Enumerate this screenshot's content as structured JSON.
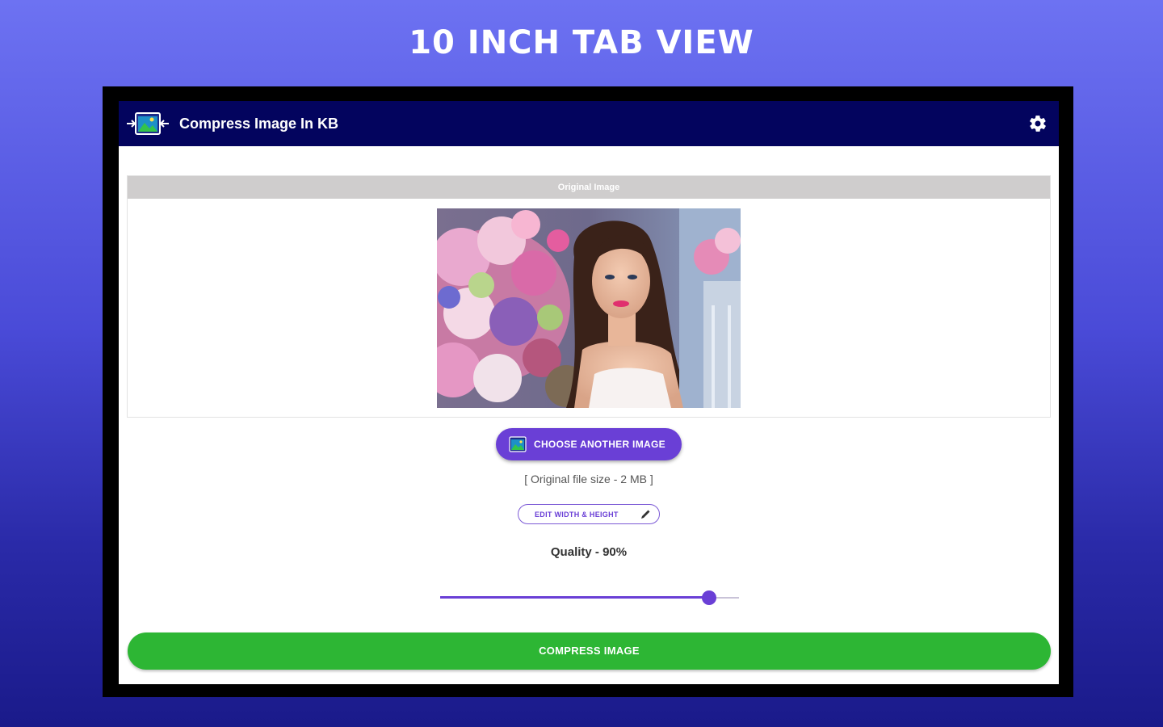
{
  "promo": {
    "title": "10 INCH TAB VIEW"
  },
  "app_bar": {
    "title": "Compress Image In KB",
    "logo_icon": "compress-image-logo-icon",
    "settings_icon": "gear-icon",
    "background_color": "#03045e"
  },
  "original_card": {
    "header": "Original Image",
    "image_description_icon": "photo"
  },
  "actions": {
    "choose_label": "CHOOSE ANOTHER IMAGE",
    "choose_icon": "image-icon",
    "file_size_text": "[ Original file size - 2 MB ]",
    "edit_label": "EDIT WIDTH & HEIGHT",
    "edit_icon": "pencil-icon"
  },
  "quality": {
    "label": "Quality - 90%",
    "value": 0.9
  },
  "compress": {
    "label": "COMPRESS IMAGE",
    "color": "#2db634"
  },
  "colors": {
    "accent": "#6a3fd6",
    "header_gray": "#cfcdcd"
  }
}
